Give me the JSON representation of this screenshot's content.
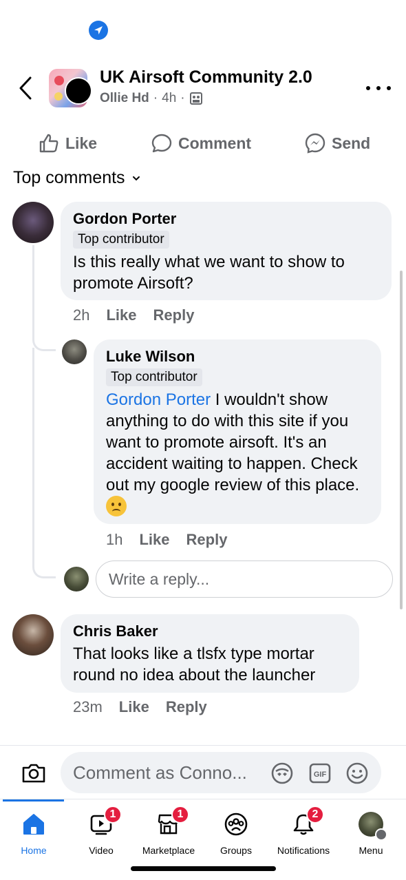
{
  "header": {
    "group_title": "UK Airsoft Community 2.0",
    "author": "Ollie Hd",
    "time": "4h",
    "separator": "·"
  },
  "actions": {
    "like": "Like",
    "comment": "Comment",
    "send": "Send"
  },
  "comments_filter": "Top comments",
  "comments": [
    {
      "name": "Gordon Porter",
      "badge": "Top contributor",
      "text": "Is this really what we want to show to promote Airsoft?",
      "time": "2h",
      "like": "Like",
      "reply": "Reply"
    },
    {
      "name": "Luke Wilson",
      "badge": "Top contributor",
      "mention": "Gordon Porter",
      "text": " I wouldn't show anything to do with this site if you want to promote airsoft. It's an accident waiting to happen. Check out my google review of this place. ",
      "time": "1h",
      "like": "Like",
      "reply": "Reply"
    },
    {
      "name": "Chris Baker",
      "text": "That looks like a tlsfx type mortar round no idea about the launcher",
      "time": "23m",
      "like": "Like",
      "reply": "Reply"
    }
  ],
  "reply_input": {
    "placeholder": "Write a reply..."
  },
  "composer": {
    "placeholder": "Comment as Conno...",
    "gif_label": "GIF"
  },
  "tabs": [
    {
      "label": "Home",
      "icon": "home-icon",
      "badge": ""
    },
    {
      "label": "Video",
      "icon": "video-icon",
      "badge": "1"
    },
    {
      "label": "Marketplace",
      "icon": "marketplace-icon",
      "badge": "1"
    },
    {
      "label": "Groups",
      "icon": "groups-icon",
      "badge": ""
    },
    {
      "label": "Notifications",
      "icon": "bell-icon",
      "badge": "2"
    },
    {
      "label": "Menu",
      "icon": "menu-avatar",
      "badge": ""
    }
  ],
  "colors": {
    "accent": "#1b74e4",
    "badge_red": "#e41e3f",
    "bubble": "#f0f2f5",
    "secondary_text": "#65676b"
  }
}
